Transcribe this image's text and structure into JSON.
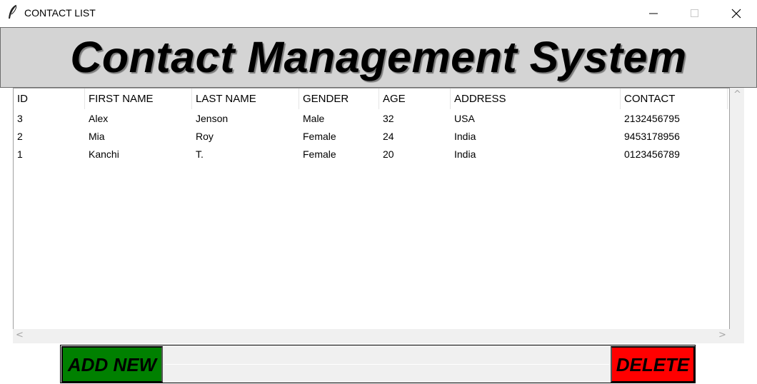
{
  "window": {
    "title": "CONTACT LIST",
    "icon": "feather-icon"
  },
  "header": {
    "title": "Contact Management System"
  },
  "table": {
    "columns": [
      "ID",
      "FIRST NAME",
      "LAST NAME",
      "GENDER",
      "AGE",
      "ADDRESS",
      "CONTACT"
    ],
    "rows": [
      [
        "3",
        "Alex",
        "Jenson",
        "Male",
        "32",
        "USA",
        "2132456795"
      ],
      [
        "2",
        "Mia",
        "Roy",
        "Female",
        "24",
        "India",
        "9453178956"
      ],
      [
        "1",
        "Kanchi",
        "T.",
        "Female",
        "20",
        "India",
        "0123456789"
      ]
    ]
  },
  "scrollbars": {
    "up": "^",
    "down": "v",
    "left": "<",
    "right": ">"
  },
  "actions": {
    "add_label": "ADD NEW",
    "delete_label": "DELETE",
    "add_color": "#008000",
    "delete_color": "#ff0000"
  }
}
